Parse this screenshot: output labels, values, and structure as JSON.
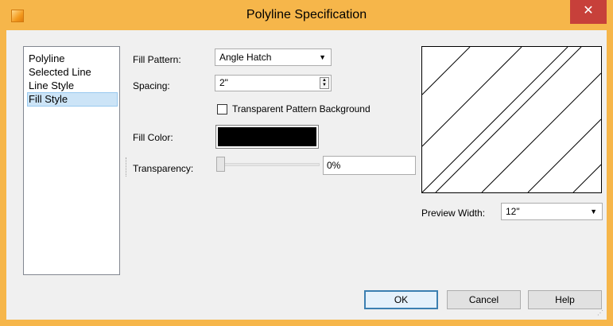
{
  "window": {
    "title": "Polyline Specification",
    "close_glyph": "✕",
    "app_icon": "app-logo-icon"
  },
  "sidebar": {
    "items": [
      {
        "label": "Polyline"
      },
      {
        "label": "Selected Line"
      },
      {
        "label": "Line Style"
      },
      {
        "label": "Fill Style",
        "selected": true
      }
    ]
  },
  "fill": {
    "pattern_label": "Fill Pattern:",
    "pattern_value": "Angle Hatch",
    "spacing_label": "Spacing:",
    "spacing_value": "2\"",
    "transparent_bg_label": "Transparent Pattern Background",
    "transparent_bg_checked": false,
    "color_label": "Fill Color:",
    "color_value": "#000000",
    "transparency_label": "Transparency:",
    "transparency_value": "0%"
  },
  "preview": {
    "width_label": "Preview Width:",
    "width_value": "12\""
  },
  "buttons": {
    "ok": "OK",
    "cancel": "Cancel",
    "help": "Help"
  },
  "colors": {
    "frame": "#f6b64a",
    "close": "#c7403a",
    "selection": "#cce4f7"
  }
}
